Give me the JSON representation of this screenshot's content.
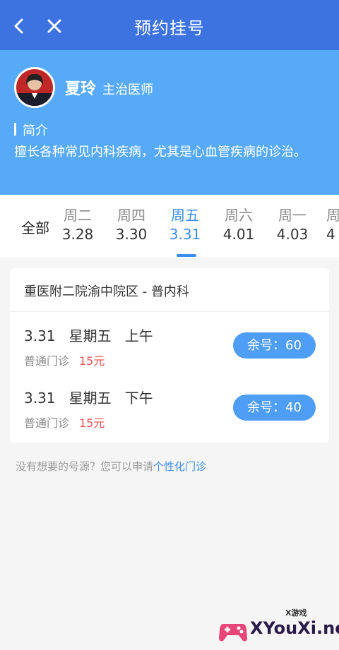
{
  "header": {
    "title": "预约挂号",
    "back_icon": "chevron-left-icon",
    "close_icon": "close-icon"
  },
  "doctor": {
    "name": "夏玲",
    "title": "主治医师",
    "intro_label": "简介",
    "intro_text": "擅长各种常见内科疾病，尤其是心血管疾病的诊治。"
  },
  "dates": {
    "all_label": "全部",
    "items": [
      {
        "weekday": "周二",
        "date": "3.28"
      },
      {
        "weekday": "周四",
        "date": "3.30"
      },
      {
        "weekday": "周五",
        "date": "3.31",
        "active": true
      },
      {
        "weekday": "周六",
        "date": "4.01"
      },
      {
        "weekday": "周一",
        "date": "4.03"
      },
      {
        "weekday": "周",
        "date": "4"
      }
    ]
  },
  "schedule": {
    "hospital": "重医附二院渝中院区 - 普内科",
    "slots": [
      {
        "date": "3.31",
        "weekday": "星期五",
        "period": "上午",
        "type": "普通门诊",
        "price": "15元",
        "button": "余号：60"
      },
      {
        "date": "3.31",
        "weekday": "星期五",
        "period": "下午",
        "type": "普通门诊",
        "price": "15元",
        "button": "余号：40"
      }
    ]
  },
  "hint": {
    "text": "没有想要的号源？您可以申请",
    "link": "个性化门诊"
  },
  "watermark": {
    "small": "X游戏",
    "big": "XYouXi.net"
  },
  "colors": {
    "header": "#3c73e0",
    "doctor_bg": "#56aaf8",
    "accent": "#3b8df0",
    "price": "#f05050"
  }
}
